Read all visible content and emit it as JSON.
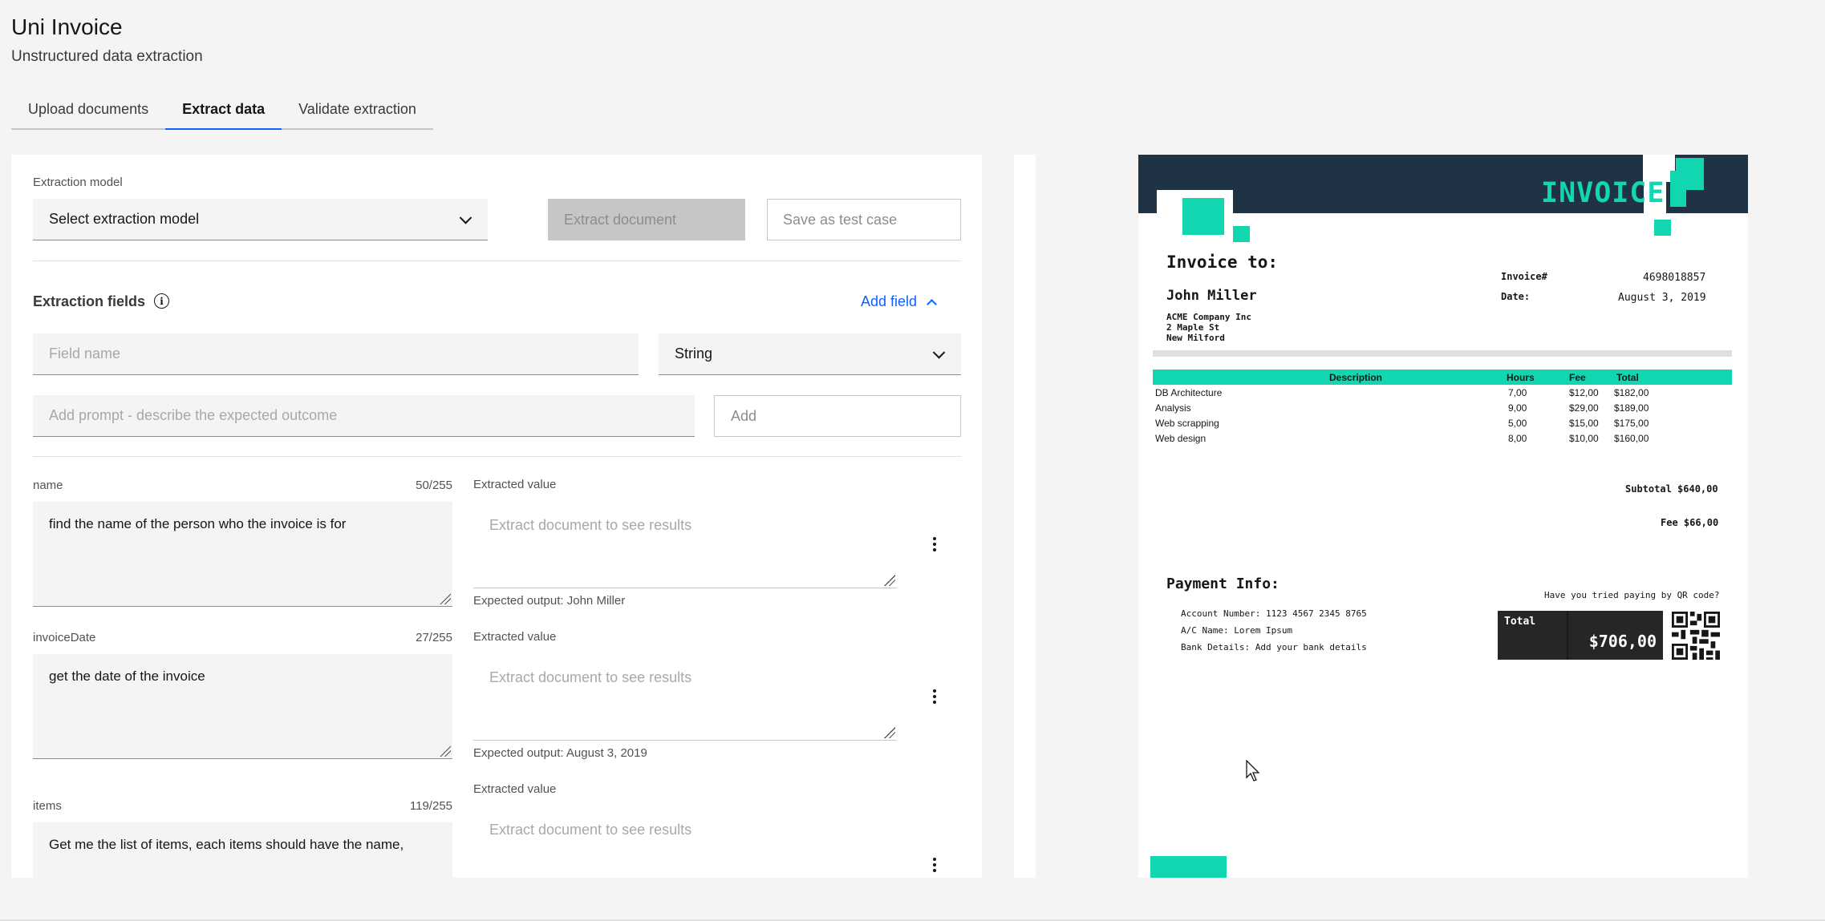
{
  "app": {
    "title": "Uni Invoice",
    "subtitle": "Unstructured data extraction"
  },
  "tabs": [
    {
      "label": "Upload documents"
    },
    {
      "label": "Extract data"
    },
    {
      "label": "Validate extraction"
    }
  ],
  "toolbar": {
    "model_label": "Extraction model",
    "model_select": "Select extraction model",
    "extract_button": "Extract document",
    "save_button": "Save as test case"
  },
  "fields_section": {
    "title": "Extraction fields",
    "add_field": "Add field",
    "field_name_placeholder": "Field name",
    "type_select": "String",
    "prompt_placeholder": "Add prompt - describe the expected outcome",
    "add_button_placeholder": "Add"
  },
  "fields": [
    {
      "name": "name",
      "count": "50/255",
      "prompt": "find the name of the person who the invoice is for",
      "value_label": "Extracted value",
      "value_placeholder": "Extract document to see results",
      "expected": "Expected output: John Miller"
    },
    {
      "name": "invoiceDate",
      "count": "27/255",
      "prompt": "get the date of the invoice",
      "value_label": "Extracted value",
      "value_placeholder": "Extract document to see results",
      "expected": "Expected output: August 3, 2019"
    },
    {
      "name": "items",
      "count": "119/255",
      "prompt": "Get me the list of items, each items should have the name,",
      "value_label": "Extracted value",
      "value_placeholder": "Extract document to see results"
    }
  ],
  "invoice": {
    "title": "INVOICE",
    "invoice_to": "Invoice to:",
    "customer": "John Miller",
    "address": [
      "ACME Company Inc",
      "2 Maple St",
      "New Milford"
    ],
    "invoice_no_label": "Invoice#",
    "invoice_no": "4698018857",
    "date_label": "Date:",
    "date": "August 3, 2019",
    "table_headers": {
      "description": "Description",
      "hours": "Hours",
      "fee": "Fee",
      "total": "Total"
    },
    "rows": [
      {
        "description": "DB Architecture",
        "hours": "7,00",
        "fee": "$12,00",
        "total": "$182,00"
      },
      {
        "description": "Analysis",
        "hours": "9,00",
        "fee": "$29,00",
        "total": "$189,00"
      },
      {
        "description": "Web scrapping",
        "hours": "5,00",
        "fee": "$15,00",
        "total": "$175,00"
      },
      {
        "description": "Web design",
        "hours": "8,00",
        "fee": "$10,00",
        "total": "$160,00"
      }
    ],
    "subtotal": "Subtotal $640,00",
    "fee": "Fee $66,00",
    "payment_title": "Payment Info:",
    "qr_prompt": "Have you tried paying by QR code?",
    "account": "Account Number: 1123 4567 2345 8765",
    "ac_name": "A/C Name: Lorem Ipsum",
    "bank": "Bank Details: Add your bank details",
    "total_label": "Total",
    "total_value": "$706,00"
  },
  "colors": {
    "accent": "#0f62fe",
    "teal": "#12d6b0",
    "navy": "#1f3344"
  }
}
